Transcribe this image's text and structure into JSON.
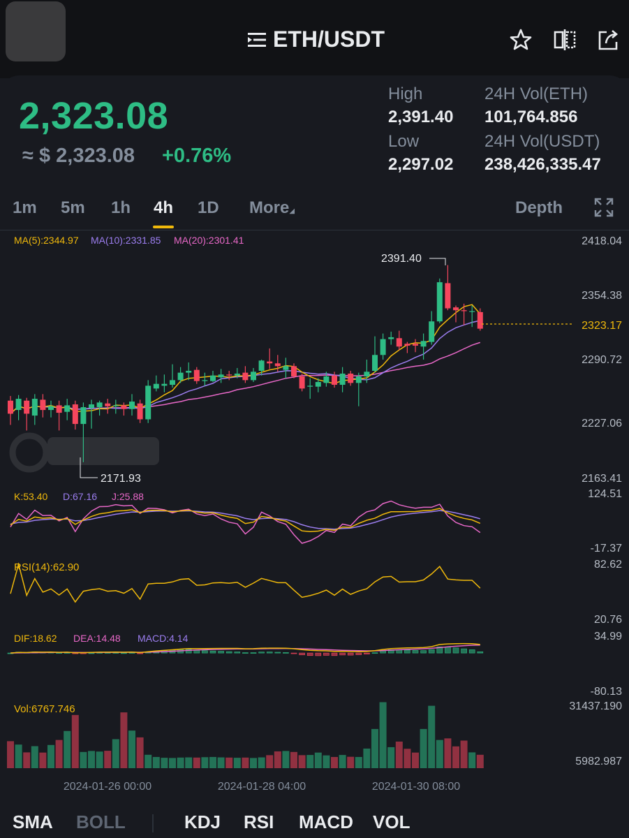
{
  "header": {
    "pair": "ETH/USDT"
  },
  "ticker": {
    "price": "2,323.08",
    "approx": "≈ $ 2,323.08",
    "change": "+0.76%",
    "high_label": "High",
    "high_value": "2,391.40",
    "low_label": "Low",
    "low_value": "2,297.02",
    "vol_eth_label": "24H Vol(ETH)",
    "vol_eth_value": "101,764.856",
    "vol_usdt_label": "24H Vol(USDT)",
    "vol_usdt_value": "238,426,335.47"
  },
  "tabs": {
    "t1m": "1m",
    "t5m": "5m",
    "t1h": "1h",
    "t4h": "4h",
    "t1d": "1D",
    "more": "More",
    "depth": "Depth",
    "active": "4h"
  },
  "colors": {
    "up": "#2ebd85",
    "down": "#f6465d",
    "ma5": "#f0b90b",
    "ma10": "#9c7ef0",
    "ma20": "#e868c8",
    "bg": "#181a20"
  },
  "icons": {
    "menu": "menu-icon",
    "star": "star-icon",
    "split": "split-view-icon",
    "share": "share-icon",
    "fullscreen": "fullscreen-icon"
  },
  "chart_data": {
    "type": "candlestick",
    "interval": "4h",
    "price_axis": {
      "ticks": [
        "2418.04",
        "2354.38",
        "2290.72",
        "2227.06",
        "2163.41"
      ],
      "range": [
        2163.41,
        2418.04
      ]
    },
    "last_price_label": "2323.17",
    "max_label": "2391.40",
    "min_label": "2171.93",
    "ma_legend": {
      "ma5": "MA(5):2344.97",
      "ma10": "MA(10):2331.85",
      "ma20": "MA(20):2301.41"
    },
    "candles": [
      [
        2246,
        2232,
        2251,
        2220
      ],
      [
        2236,
        2248,
        2252,
        2225
      ],
      [
        2246,
        2232,
        2249,
        2214
      ],
      [
        2230,
        2248,
        2253,
        2220
      ],
      [
        2247,
        2236,
        2253,
        2228
      ],
      [
        2236,
        2240,
        2246,
        2228
      ],
      [
        2241,
        2233,
        2246,
        2214
      ],
      [
        2234,
        2241,
        2248,
        2225
      ],
      [
        2242,
        2221,
        2246,
        2215
      ],
      [
        2221,
        2239,
        2244,
        2180
      ],
      [
        2238,
        2242,
        2247,
        2216
      ],
      [
        2239,
        2244,
        2246,
        2230
      ],
      [
        2243,
        2240,
        2248,
        2232
      ],
      [
        2240,
        2241,
        2247,
        2232
      ],
      [
        2241,
        2237,
        2244,
        2230
      ],
      [
        2237,
        2245,
        2253,
        2230
      ],
      [
        2243,
        2226,
        2247,
        2222
      ],
      [
        2226,
        2262,
        2268,
        2222
      ],
      [
        2259,
        2264,
        2273,
        2256
      ],
      [
        2262,
        2264,
        2274,
        2255
      ],
      [
        2263,
        2268,
        2285,
        2260
      ],
      [
        2268,
        2276,
        2282,
        2265
      ],
      [
        2276,
        2278,
        2287,
        2268
      ],
      [
        2279,
        2267,
        2282,
        2264
      ],
      [
        2267,
        2268,
        2276,
        2262
      ],
      [
        2267,
        2273,
        2278,
        2266
      ],
      [
        2271,
        2274,
        2280,
        2265
      ],
      [
        2274,
        2273,
        2278,
        2268
      ],
      [
        2273,
        2275,
        2281,
        2270
      ],
      [
        2276,
        2268,
        2283,
        2265
      ],
      [
        2268,
        2277,
        2281,
        2266
      ],
      [
        2278,
        2289,
        2290,
        2273
      ],
      [
        2288,
        2286,
        2302,
        2280
      ],
      [
        2286,
        2283,
        2295,
        2277
      ],
      [
        2279,
        2283,
        2292,
        2270
      ],
      [
        2283,
        2272,
        2286,
        2270
      ],
      [
        2272,
        2259,
        2275,
        2256
      ],
      [
        2261,
        2262,
        2270,
        2248
      ],
      [
        2261,
        2266,
        2270,
        2255
      ],
      [
        2265,
        2272,
        2277,
        2261
      ],
      [
        2273,
        2263,
        2277,
        2260
      ],
      [
        2263,
        2275,
        2282,
        2255
      ],
      [
        2275,
        2265,
        2278,
        2262
      ],
      [
        2265,
        2272,
        2276,
        2240
      ],
      [
        2272,
        2277,
        2290,
        2265
      ],
      [
        2278,
        2295,
        2315,
        2276
      ],
      [
        2295,
        2312,
        2318,
        2290
      ],
      [
        2312,
        2314,
        2320,
        2306
      ],
      [
        2313,
        2304,
        2321,
        2300
      ],
      [
        2307,
        2305,
        2309,
        2297
      ],
      [
        2307,
        2305,
        2312,
        2298
      ],
      [
        2304,
        2310,
        2318,
        2290
      ],
      [
        2309,
        2331,
        2342,
        2306
      ],
      [
        2331,
        2373,
        2377,
        2329
      ],
      [
        2372,
        2345,
        2391.4,
        2343
      ],
      [
        2346,
        2343,
        2348,
        2330
      ],
      [
        2343,
        2342,
        2350,
        2327
      ],
      [
        2342,
        2342,
        2348,
        2325
      ],
      [
        2341,
        2323.17,
        2345,
        2321
      ]
    ],
    "kdj": {
      "legend": {
        "k": "K:53.40",
        "d": "D:67.16",
        "j": "J:25.88"
      },
      "axis": [
        "124.51",
        "-17.37"
      ]
    },
    "rsi": {
      "legend": "RSI(14):62.90",
      "axis": [
        "82.62",
        "20.76"
      ]
    },
    "macd": {
      "legend": {
        "dif": "DIF:18.62",
        "dea": "DEA:14.48",
        "macd": "MACD:4.14"
      },
      "axis": [
        "34.99",
        "-80.13"
      ]
    },
    "volume": {
      "legend": "Vol:6767.746",
      "axis": [
        "31437.190",
        "5982.987"
      ],
      "values": [
        13500,
        11800,
        7900,
        11000,
        7800,
        11600,
        14100,
        18600,
        26600,
        8100,
        8600,
        8300,
        8700,
        14500,
        27900,
        18800,
        15400,
        6700,
        5600,
        5200,
        5100,
        5300,
        5400,
        5300,
        5500,
        5600,
        5400,
        5300,
        5200,
        5300,
        5100,
        5400,
        6500,
        8400,
        8600,
        8100,
        6500,
        6600,
        7800,
        6400,
        5600,
        6600,
        5700,
        5600,
        9800,
        19600,
        33000,
        10500,
        13300,
        9700,
        7800,
        19600,
        31200,
        14100,
        14900,
        10900,
        13800,
        7900,
        6700
      ]
    },
    "time_axis": [
      "2024-01-26 00:00",
      "2024-01-28 04:00",
      "2024-01-30 08:00"
    ]
  },
  "indicators": {
    "sma": "SMA",
    "boll": "BOLL",
    "kdj": "KDJ",
    "rsi": "RSI",
    "macd": "MACD",
    "vol": "VOL"
  }
}
